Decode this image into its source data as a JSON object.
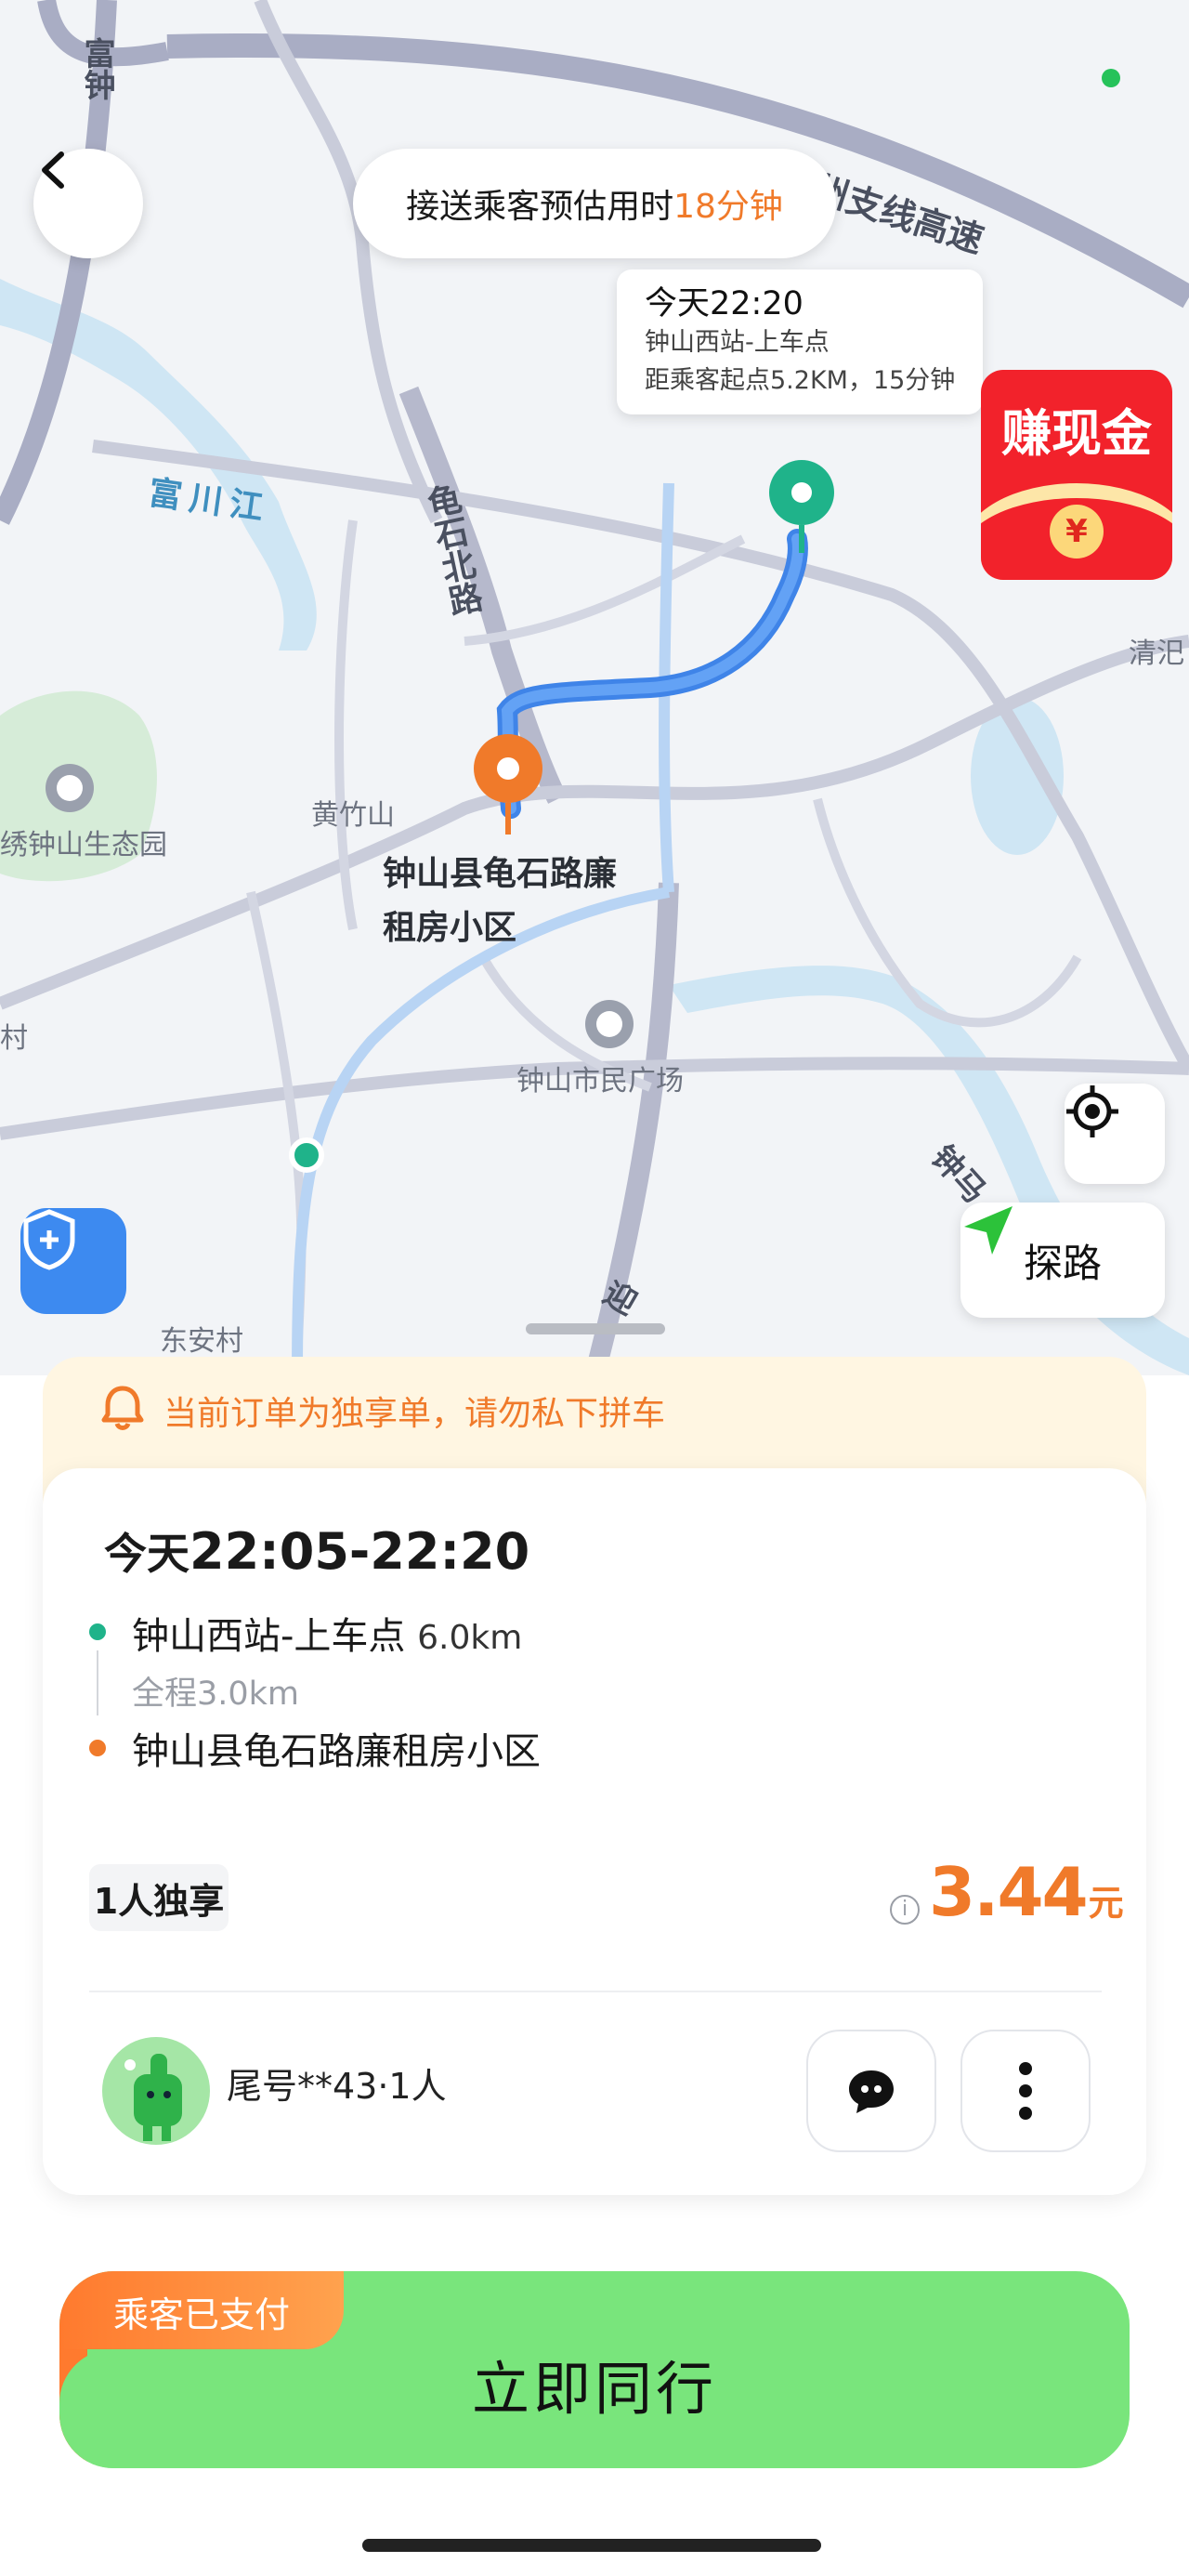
{
  "map": {
    "eta_prefix": "接送乘客预估用时",
    "eta_value": "18分钟",
    "pickup_card": {
      "time": "今天22:20",
      "place": "钟山西站-上车点",
      "distance": "距乘客起点5.2KM，15分钟"
    },
    "promo_text": "赚现金",
    "promo_symbol": "¥",
    "destination_label_line1": "钟山县龟石路廉",
    "destination_label_line2": "租房小区",
    "explore_label": "探路",
    "labels": {
      "fuzhong": "富钟",
      "hezhou_highway": "贺州支线高速",
      "fuchuan_river": "富川江",
      "guishi_north_road": "龟石北路",
      "qingxiang": "清汜",
      "huangzhu_mountain": "黄竹山",
      "eco_park": "绣钟山生态园",
      "cun": "村",
      "civic_square": "钟山市民广场",
      "dongan_village": "东安村",
      "zhong": "钟马",
      "ying": "迎"
    }
  },
  "notice": "当前订单为独享单，请勿私下拼车",
  "trip": {
    "time_prefix": "今天",
    "time_range": "22:05-22:20",
    "pickup": "钟山西站-上车点",
    "pickup_distance": "6.0km",
    "total": "全程3.0km",
    "dropoff": "钟山县龟石路廉租房小区",
    "seat_type": "1人独享",
    "price": "3.44",
    "currency": "元",
    "passenger": "尾号**43·1人"
  },
  "payment_badge": "乘客已支付",
  "cta": "立即同行",
  "colors": {
    "accent_orange": "#f07a2a",
    "route_blue": "#4a90f0",
    "pickup_green": "#1fb38a",
    "cta_green": "#79e57c",
    "promo_red": "#f2222b"
  }
}
